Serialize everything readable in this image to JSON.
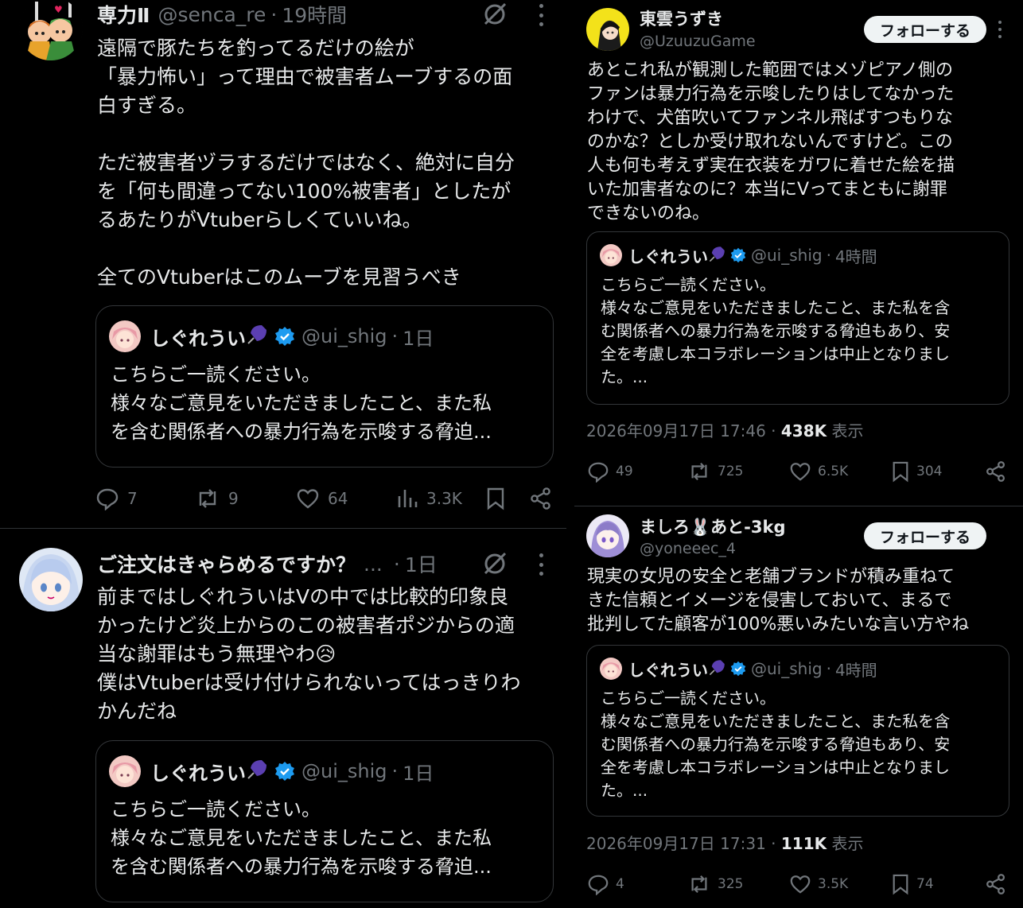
{
  "left_tweets": [
    {
      "name": "専力Ⅱ",
      "handle": "@senca_re",
      "time": "19時間",
      "text": "遠隔で豚たちを釣ってるだけの絵が\n「暴力怖い」って理由で被害者ムーブするの面\n白すぎる。\n\nただ被害者ヅラするだけではなく、絶対に自分\nを「何も間違ってない100%被害者」としたが\nるあたりがVtuberらしくていいね。\n\n全てのVtuberはこのムーブを見習うべき",
      "quote": {
        "name": "しぐれうい",
        "handle": "@ui_shig",
        "time": "1日",
        "text": "こちらご一読ください。\n様々なご意見をいただきましたこと、また私\nを含む関係者への暴力行為を示唆する脅迫..."
      },
      "stats": {
        "replies": "7",
        "reposts": "9",
        "likes": "64",
        "views": "3.3K"
      }
    },
    {
      "name": "ご注文はきゃらめるですか？",
      "handle": "...",
      "time": "1日",
      "text": "前まではしぐれういはVの中では比較的印象良\nかったけど炎上からのこの被害者ポジからの適\n当な謝罪はもう無理やわ😥\n僕はVtuberは受け付けられないってはっきりわ\nかんだね",
      "quote": {
        "name": "しぐれうい",
        "handle": "@ui_shig",
        "time": "1日",
        "text": "こちらご一読ください。\n様々なご意見をいただきましたこと、また私\nを含む関係者への暴力行為を示唆する脅迫..."
      }
    }
  ],
  "right_tweets": [
    {
      "name": "東雲うずき",
      "handle": "@UzuuzuGame",
      "follow_label": "フォローする",
      "text": "あとこれ私が観測した範囲ではメゾピアノ側の\nファンは暴力行為を示唆したりはしてなかった\nわけで、犬笛吹いてファンネル飛ばすつもりな\nのかな？としか受け取れないんですけど。この\n人も何も考えず実在衣装をガワに着せた絵を描\nいた加害者なのに？本当にVってまともに謝罪\nできないのね。",
      "quote": {
        "name": "しぐれうい",
        "handle": "@ui_shig",
        "time": "4時間",
        "text": "こちらご一読ください。\n様々なご意見をいただきましたこと、また私を含\nむ関係者への暴力行為を示唆する脅迫もあり、安\n全を考慮し本コラボレーションは中止となりまし\nた。..."
      },
      "timestamp": "2026年09月17日 17:46",
      "views": "438K",
      "views_label": "表示",
      "stats": {
        "replies": "49",
        "reposts": "725",
        "likes": "6.5K",
        "bookmarks": "304"
      }
    },
    {
      "name": "ましろ🐰あと-3kg",
      "handle": "@yoneeec_4",
      "follow_label": "フォローする",
      "text": "現実の女児の安全と老舗ブランドが積み重ねて\nきた信頼とイメージを侵害しておいて、まるで\n批判してた顧客が100%悪いみたいな言い方やね",
      "quote": {
        "name": "しぐれうい",
        "handle": "@ui_shig",
        "time": "4時間",
        "text": "こちらご一読ください。\n様々なご意見をいただきましたこと、また私を含\nむ関係者への暴力行為を示唆する脅迫もあり、安\n全を考慮し本コラボレーションは中止となりまし\nた。..."
      },
      "timestamp": "2026年09月17日 17:31",
      "views": "111K",
      "views_label": "表示",
      "stats": {
        "replies": "4",
        "reposts": "325",
        "likes": "3.5K",
        "bookmarks": "74"
      }
    }
  ],
  "sep": "·",
  "colors": {
    "background": "#000000",
    "text": "#e7e9ea",
    "muted": "#71767b",
    "verified": "#1d9bf0",
    "border": "#333639"
  }
}
